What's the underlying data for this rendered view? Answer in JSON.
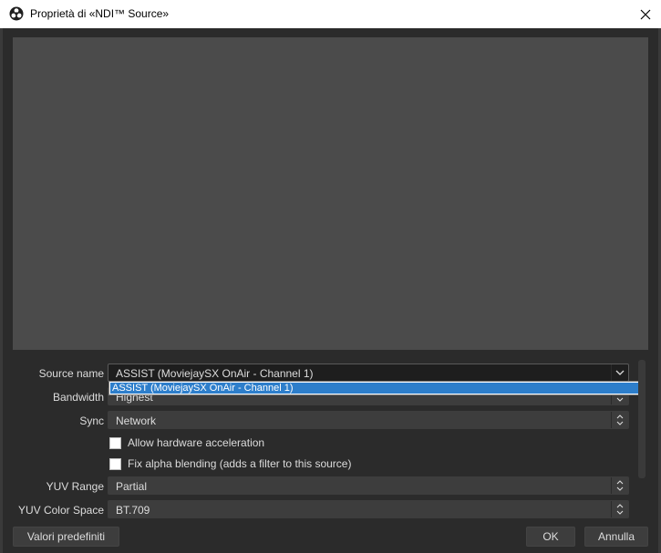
{
  "window": {
    "title": "Proprietà di «NDI™ Source»",
    "close_icon": "close-icon"
  },
  "properties": {
    "source_name": {
      "label": "Source name",
      "value": "ASSIST (MoviejaySX OnAir - Channel 1)",
      "dropdown_options": [
        "ASSIST (MoviejaySX OnAir - Channel 1)"
      ]
    },
    "bandwidth": {
      "label": "Bandwidth",
      "value": "Highest"
    },
    "sync": {
      "label": "Sync",
      "value": "Network"
    },
    "allow_hw_accel": {
      "label": "Allow hardware acceleration",
      "checked": false
    },
    "fix_alpha": {
      "label": "Fix alpha blending (adds a filter to this source)",
      "checked": false
    },
    "yuv_range": {
      "label": "YUV Range",
      "value": "Partial"
    },
    "yuv_color_space": {
      "label": "YUV Color Space",
      "value": "BT.709"
    }
  },
  "buttons": {
    "defaults": "Valori predefiniti",
    "ok": "OK",
    "cancel": "Annulla"
  }
}
